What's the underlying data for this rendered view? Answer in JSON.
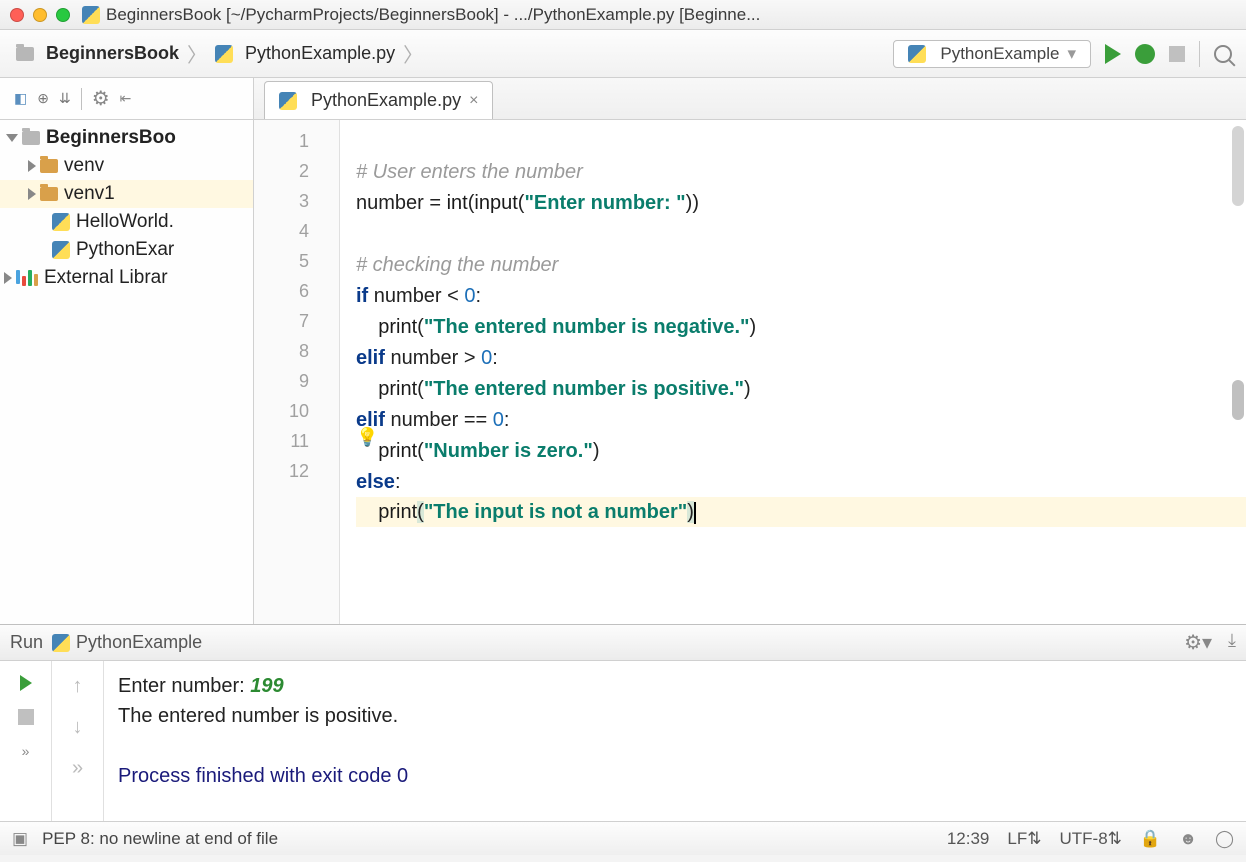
{
  "window": {
    "title": "BeginnersBook [~/PycharmProjects/BeginnersBook] - .../PythonExample.py [Beginne..."
  },
  "breadcrumb": {
    "project": "BeginnersBook",
    "file": "PythonExample.py"
  },
  "runconfig": {
    "name": "PythonExample"
  },
  "tree": {
    "root": "BeginnersBoo",
    "venv": "venv",
    "venv1": "venv1",
    "hello": "HelloWorld.",
    "pyex": "PythonExar",
    "extlib": "External Librar"
  },
  "tab": {
    "name": "PythonExample.py"
  },
  "gutter": [
    "1",
    "2",
    "3",
    "4",
    "5",
    "6",
    "7",
    "8",
    "9",
    "10",
    "11",
    "12"
  ],
  "strings": {
    "comment1": "# User enters the number",
    "enter": "\"Enter number: \"",
    "comment2": "# checking the number",
    "neg": "\"The entered number is negative.\"",
    "pos": "\"The entered number is positive.\"",
    "zero": "\"Number is zero.\"",
    "notnum": "\"The input is not a number\""
  },
  "kw": {
    "if": "if",
    "elif": "elif",
    "else": "else",
    "print": "print",
    "int": "int",
    "input": "input",
    "number": "number",
    "assign": "number = ",
    "zero": "0"
  },
  "run": {
    "label": "Run",
    "name": "PythonExample",
    "prompt": "Enter number: ",
    "input": "199",
    "out1": "The entered number is positive.",
    "exit": "Process finished with exit code 0"
  },
  "status": {
    "msg": "PEP 8: no newline at end of file",
    "pos": "12:39",
    "le": "LF",
    "enc": "UTF-8"
  }
}
